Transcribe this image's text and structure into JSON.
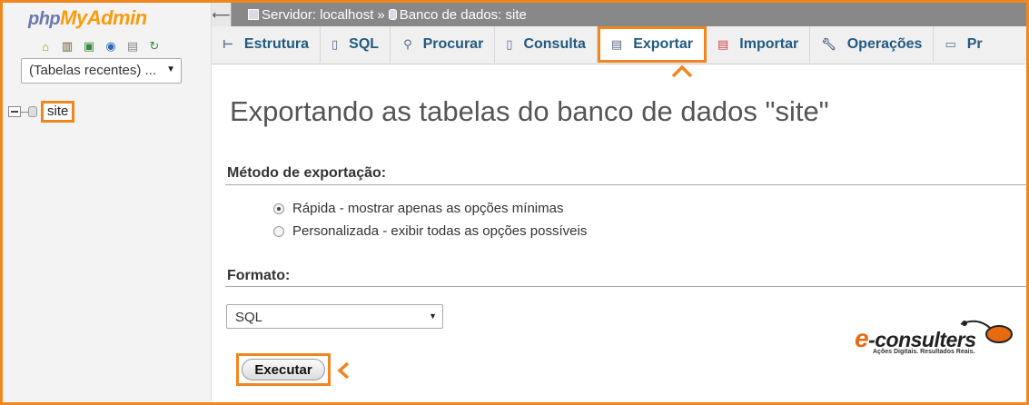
{
  "logo": {
    "php": "php",
    "my": "My",
    "admin": "Admin"
  },
  "left_panel": {
    "quick_icons": [
      "home-icon",
      "logout-icon",
      "query-window-icon",
      "help-icon",
      "docs-icon",
      "reload-icon"
    ],
    "recent_tables": "(Tabelas recentes) ...",
    "tree": [
      {
        "label": "site"
      }
    ]
  },
  "breadcrumb": {
    "server": "Servidor: localhost",
    "separator": "»",
    "database": "Banco de dados: site"
  },
  "tabs": [
    {
      "label": "Estrutura",
      "icon": "structure-icon"
    },
    {
      "label": "SQL",
      "icon": "sql-icon"
    },
    {
      "label": "Procurar",
      "icon": "search-icon"
    },
    {
      "label": "Consulta",
      "icon": "query-icon"
    },
    {
      "label": "Exportar",
      "icon": "export-icon",
      "active": true
    },
    {
      "label": "Importar",
      "icon": "import-icon"
    },
    {
      "label": "Operações",
      "icon": "wrench-icon"
    },
    {
      "label": "Pr",
      "icon": "privileges-icon"
    }
  ],
  "main": {
    "title": "Exportando as tabelas do banco de dados \"site\"",
    "method": {
      "heading": "Método de exportação:",
      "options": [
        {
          "label": "Rápida - mostrar apenas as opções mínimas",
          "checked": true
        },
        {
          "label": "Personalizada - exibir todas as opções possíveis",
          "checked": false
        }
      ]
    },
    "format": {
      "heading": "Formato:",
      "selected": "SQL"
    },
    "execute_label": "Executar"
  },
  "brand": {
    "e": "e",
    "name": "-consulters",
    "tagline": "Ações Digitais. Resultados Reais."
  },
  "colors": {
    "highlight": "#f0861f",
    "tab_text": "#235a81",
    "topbar": "#888888"
  }
}
